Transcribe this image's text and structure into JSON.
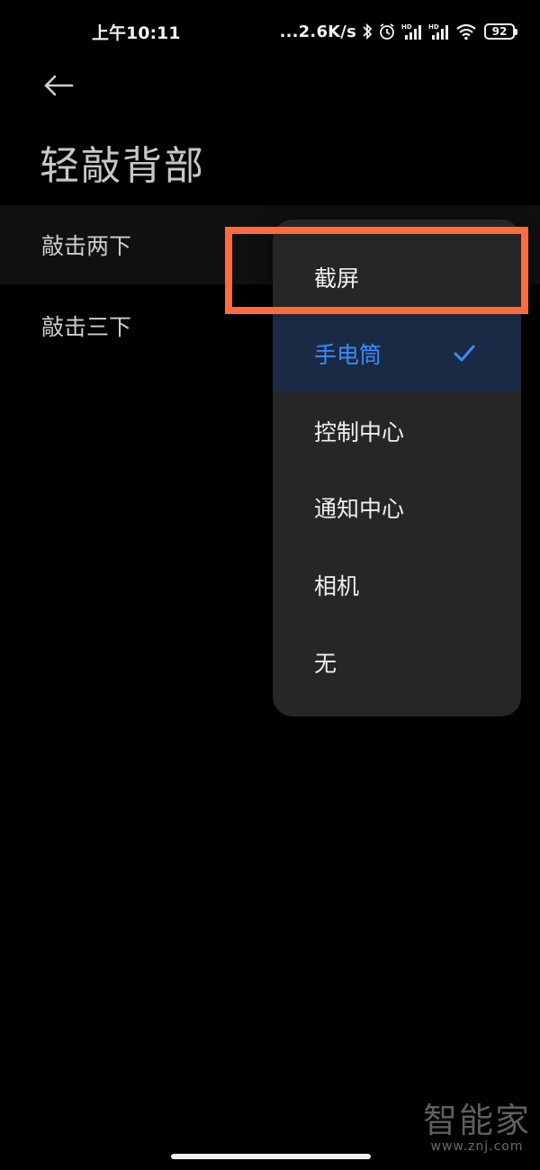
{
  "status_bar": {
    "time": "上午10:11",
    "network_speed": "...2.6K/s",
    "battery_level": "92",
    "signal_label": "HD",
    "icons": [
      "bluetooth-icon",
      "alarm-icon",
      "signal-hd-icon",
      "signal-hd-icon",
      "wifi-icon",
      "battery-icon"
    ]
  },
  "header": {
    "back_icon": "back-arrow-icon",
    "title": "轻敲背部"
  },
  "settings": {
    "double_tap_label": "敲击两下",
    "triple_tap_label": "敲击三下"
  },
  "dropdown": {
    "items": [
      {
        "label": "截屏",
        "selected": false
      },
      {
        "label": "手电筒",
        "selected": true
      },
      {
        "label": "控制中心",
        "selected": false
      },
      {
        "label": "通知中心",
        "selected": false
      },
      {
        "label": "相机",
        "selected": false
      },
      {
        "label": "无",
        "selected": false
      }
    ],
    "selected_check_icon": "checkmark-icon"
  },
  "annotation": {
    "highlight_color": "#ff6b3d"
  },
  "watermark": {
    "logo_text": "智能家",
    "url": "www.znj.com"
  },
  "colors": {
    "accent": "#3d8bf5",
    "background": "#000000",
    "menu_background": "#262626"
  }
}
